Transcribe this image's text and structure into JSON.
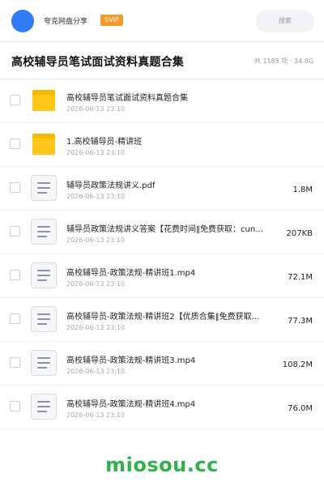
{
  "header": {
    "share_name": "夸克网盘分享",
    "badge": "SVIP",
    "search_placeholder": "搜索"
  },
  "titlebar": {
    "title": "高校辅导员笔试面试资料真题合集",
    "meta": "共 1185 项 · 34.8G"
  },
  "files": [
    {
      "type": "folder",
      "name": "高校辅导员笔试面试资料真题合集",
      "date": "2026-06-13 23:10",
      "size": ""
    },
    {
      "type": "folder",
      "name": "1.高校辅导员-精讲班",
      "date": "2026-06-13 23:10",
      "size": ""
    },
    {
      "type": "file",
      "name": "辅导员政策法规讲义.pdf",
      "date": "2026-06-13 23:10",
      "size": "1.8M"
    },
    {
      "type": "file",
      "name": "辅导员政策法规讲义答案【花费时间‖免费获取：cun…",
      "date": "2026-06-13 23:10",
      "size": "207KB"
    },
    {
      "type": "file",
      "name": "高校辅导员-政策法规-精讲班1.mp4",
      "date": "2026-06-13 23:10",
      "size": "72.1M"
    },
    {
      "type": "file",
      "name": "高校辅导员-政策法规-精讲班2【优质合集‖免费获取…",
      "date": "2026-06-13 23:10",
      "size": "77.3M"
    },
    {
      "type": "file",
      "name": "高校辅导员-政策法规-精讲班3.mp4",
      "date": "2026-06-13 23:10",
      "size": "108.2M"
    },
    {
      "type": "file",
      "name": "高校辅导员-政策法规-精讲班4.mp4",
      "date": "2026-06-13 23:10",
      "size": "76.0M"
    }
  ],
  "watermark": "miosou.cc",
  "colors": {
    "avatar": "#2f7cf6",
    "svip": "#f39a2a",
    "folder": "#ffc61a",
    "watermark": "#2fb24a"
  }
}
